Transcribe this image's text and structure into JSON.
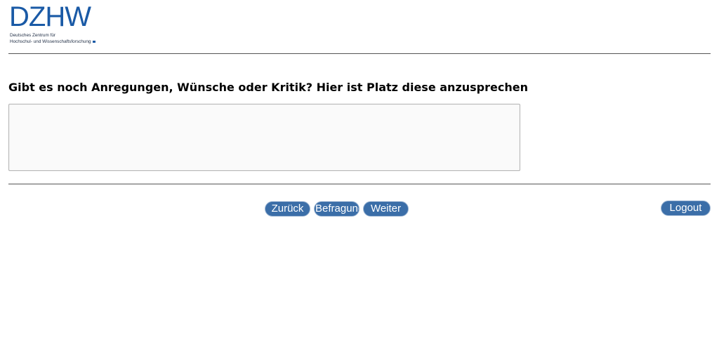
{
  "logo": {
    "mark": "DZHW",
    "subtitle_line1": "Deutsches Zentrum für",
    "subtitle_line2": "Hochschul- und Wissenschaftsforschung"
  },
  "question": {
    "text": "Gibt es noch Anregungen, Wünsche oder Kritik? Hier ist Platz diese anzusprechen",
    "answer_value": ""
  },
  "nav": {
    "back_label": "Zurück",
    "survey_label": "Befragung",
    "next_label": "Weiter",
    "logout_label": "Logout"
  },
  "colors": {
    "brand": "#1a5aa6",
    "button": "#3b6ea8"
  }
}
